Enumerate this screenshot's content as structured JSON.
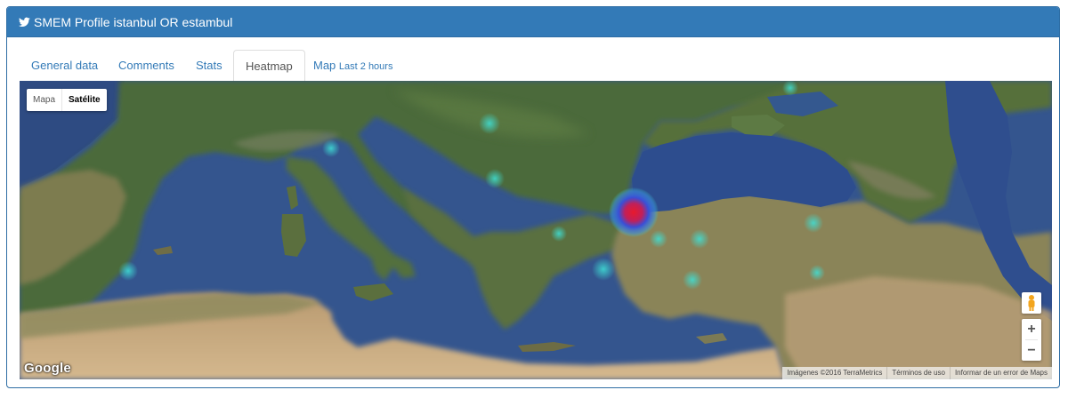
{
  "header": {
    "icon": "twitter-bird-icon",
    "title": "SMEM Profile istanbul OR estambul",
    "bg_color": "#337ab7"
  },
  "tabs": [
    {
      "label": "General data",
      "active": false
    },
    {
      "label": "Comments",
      "active": false
    },
    {
      "label": "Stats",
      "active": false
    },
    {
      "label": "Heatmap",
      "active": true
    },
    {
      "label": "Map",
      "suffix": "Last 2 hours",
      "active": false
    }
  ],
  "map": {
    "type_options": [
      {
        "label": "Mapa",
        "selected": false
      },
      {
        "label": "Satélite",
        "selected": true
      }
    ],
    "pegman_icon": "street-view-pegman-icon",
    "zoom_in_label": "+",
    "zoom_out_label": "−",
    "logo_text": "Google",
    "attribution": {
      "imagery": "Imágenes ©2016 TerraMetrics",
      "terms": "Términos de uso",
      "report": "Informar de un error de Maps"
    },
    "heat_colors": {
      "hot": "#e8192c",
      "warm": "#3a4fd6",
      "cool": "#3fd6d6"
    }
  }
}
